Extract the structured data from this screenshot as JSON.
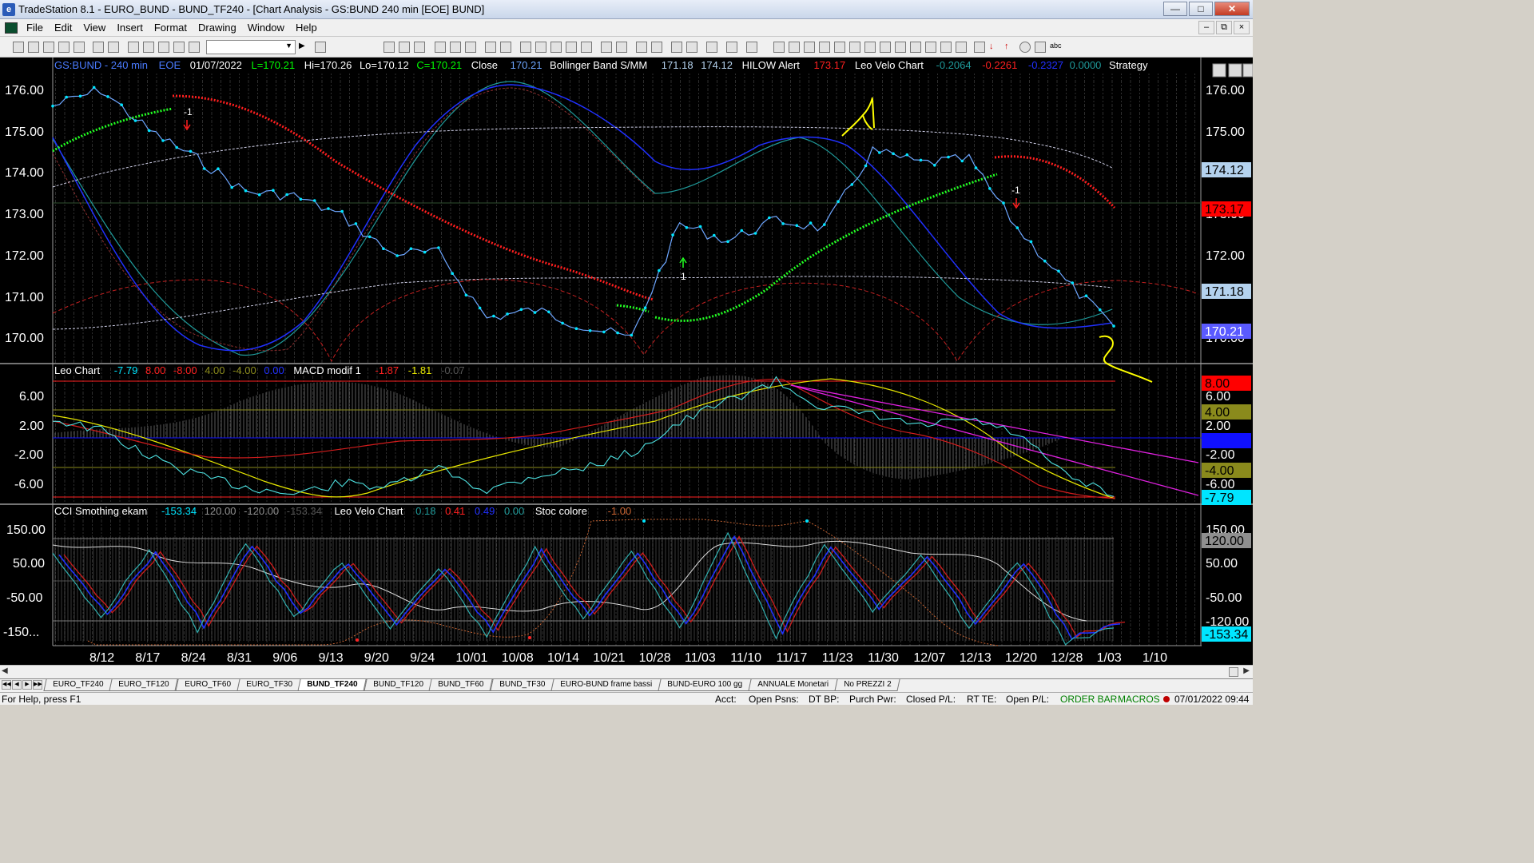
{
  "window": {
    "title": "TradeStation 8.1 - EURO_BUND - BUND_TF240 - [Chart Analysis - GS:BUND  240 min  [EOE] BUND]",
    "minimize": "—",
    "maximize": "□",
    "close": "✕"
  },
  "menu": [
    "File",
    "Edit",
    "View",
    "Insert",
    "Format",
    "Drawing",
    "Window",
    "Help"
  ],
  "chart_header": {
    "symbol": "GS:BUND - 240 min",
    "session": "EOE",
    "date": "01/07/2022",
    "low_label": "L=170.21",
    "hi": "Hi=170.26",
    "lo": "Lo=170.12",
    "close_c": "C=170.21",
    "close_label": "Close",
    "close_val": "170.21",
    "bb_label": "Bollinger Band S/MM",
    "bb_v1": "171.18",
    "bb_v2": "174.12",
    "hilow_label": "HILOW Alert",
    "hilow_val": "173.17",
    "leo_velo_label": "Leo Velo Chart",
    "lv1": "-0.2064",
    "lv2": "-0.2261",
    "lv3": "-0.2327",
    "lv4": "0.0000",
    "strategy": "Strategy"
  },
  "panel2_header": {
    "leo_label": "Leo Chart",
    "v1": "-7.79",
    "v2": "8.00",
    "v3": "-8.00",
    "v4": "4.00",
    "v5": "-4.00",
    "v6": "0.00",
    "macd_label": "MACD modif 1",
    "m1": "-1.87",
    "m2": "-1.81",
    "m3": "-0.07"
  },
  "panel3_header": {
    "cci_label": "CCI Smothing ekam",
    "c1": "-153.34",
    "c2": "120.00",
    "c3": "-120.00",
    "c4": "-153.34",
    "lv_label": "Leo Velo Chart",
    "l1": "0.18",
    "l2": "0.41",
    "l3": "0.49",
    "l4": "0.00",
    "stoc_label": "Stoc colore",
    "s1": "-1.00"
  },
  "annotations": {
    "sig_minus1_a": "-1",
    "sig_minus1_b": "-1",
    "sig_plus1": "1"
  },
  "axis1": {
    "left_ticks": [
      "176.00",
      "175.00",
      "174.00",
      "173.00",
      "172.00",
      "171.00",
      "170.00"
    ],
    "right_ticks": [
      "176.00",
      "175.00",
      "173.00",
      "172.00",
      "170.00"
    ],
    "badges": [
      {
        "label": "174.12",
        "color": "#b4d2ee",
        "text_color": "#000000"
      },
      {
        "label": "173.17",
        "color": "#ff0000",
        "text_color": "#000000"
      },
      {
        "label": "171.18",
        "color": "#b4d2ee",
        "text_color": "#000000"
      },
      {
        "label": "170.21",
        "color": "#5a5aff",
        "text_color": "#ffffff"
      }
    ]
  },
  "axis2": {
    "left_ticks": [
      "6.00",
      "2.00",
      "-2.00",
      "-6.00"
    ],
    "right_ticks": [
      "6.00",
      "2.00",
      "-2.00",
      "-6.00"
    ],
    "badges": [
      {
        "label": "8.00",
        "color": "#ff0000",
        "text_color": "#000000"
      },
      {
        "label": "4.00",
        "color": "#8a8a1c",
        "text_color": "#000000"
      },
      {
        "label": "0.00",
        "color": "#1010ff",
        "text_color": "#1010ff"
      },
      {
        "label": "-4.00",
        "color": "#8a8a1c",
        "text_color": "#000000"
      },
      {
        "label": "-7.79",
        "color": "#00e5ff",
        "text_color": "#000000"
      }
    ]
  },
  "axis3": {
    "left_ticks": [
      "150.00",
      "50.00",
      "-50.00",
      "-150..."
    ],
    "right_ticks": [
      "150.00",
      "50.00",
      "-50.00",
      "-120.00"
    ],
    "badges": [
      {
        "label": "120.00",
        "color": "#8f8f8f",
        "text_color": "#000000"
      },
      {
        "label": "-153.34",
        "color": "#00e5ff",
        "text_color": "#000000"
      }
    ]
  },
  "x_axis": {
    "dates": [
      "8/12",
      "8/17",
      "8/24",
      "8/31",
      "9/06",
      "9/13",
      "9/20",
      "9/24",
      "10/01",
      "10/08",
      "10/14",
      "10/21",
      "10/28",
      "11/03",
      "11/10",
      "11/17",
      "11/23",
      "11/30",
      "12/07",
      "12/13",
      "12/20",
      "12/28",
      "1/03",
      "1/10"
    ]
  },
  "sheet_tabs": [
    {
      "label": "EURO_TF240",
      "active": false
    },
    {
      "label": "EURO_TF120",
      "active": false
    },
    {
      "label": "EURO_TF60",
      "active": false
    },
    {
      "label": "EURO_TF30",
      "active": false
    },
    {
      "label": "BUND_TF240",
      "active": true
    },
    {
      "label": "BUND_TF120",
      "active": false
    },
    {
      "label": "BUND_TF60",
      "active": false
    },
    {
      "label": "BUND_TF30",
      "active": false
    },
    {
      "label": "EURO-BUND frame bassi",
      "active": false
    },
    {
      "label": "BUND-EURO 100 gg",
      "active": false
    },
    {
      "label": "ANNUALE Monetari",
      "active": false
    },
    {
      "label": "No PREZZI 2",
      "active": false
    }
  ],
  "status": {
    "help": "For Help, press F1",
    "acct": "Acct:",
    "open_psns": "Open Psns:",
    "dt_bp": "DT BP:",
    "purch_pwr": "Purch Pwr:",
    "closed_pl": "Closed P/L:",
    "rt_te": "RT TE:",
    "open_pl": "Open P/L:",
    "order_bar": "ORDER BAR",
    "macros": "MACROS",
    "datetime": "07/01/2022 09:44"
  },
  "chart_data": {
    "type": "line",
    "xlabel": "",
    "ylabel": "",
    "x": [
      "8/12",
      "8/17",
      "8/24",
      "8/31",
      "9/06",
      "9/13",
      "9/20",
      "9/24",
      "10/01",
      "10/08",
      "10/14",
      "10/21",
      "10/28",
      "11/03",
      "11/10",
      "11/17",
      "11/23",
      "11/30",
      "12/07",
      "12/13",
      "12/20",
      "12/28",
      "1/03"
    ],
    "panels": [
      {
        "name": "price",
        "ylim": [
          169.3,
          176.4
        ],
        "series": [
          {
            "values": [
              175.6,
              176.0,
              175.0,
              174.3,
              173.5,
              173.4,
              172.9,
              172.0,
              172.0,
              170.4,
              170.6,
              170.2,
              169.9,
              172.7,
              172.3,
              172.8,
              172.6,
              174.5,
              174.2,
              174.3,
              172.6,
              171.3,
              170.2
            ]
          }
        ],
        "color_line": "#00e5ff"
      },
      {
        "name": "leo_chart_macd",
        "ylim": [
          -8.5,
          8.5
        ],
        "series": [
          {
            "values": [
              2.5,
              1.0,
              -2.5,
              -5.0,
              -6.5,
              -7.5,
              -6.0,
              -6.5,
              -4.0,
              -7.0,
              -5.0,
              -4.0,
              -2.0,
              2.0,
              5.0,
              7.5,
              4.0,
              3.0,
              1.5,
              2.5,
              0.5,
              -5.0,
              -7.79
            ]
          }
        ],
        "color_line": "#4de0e0"
      },
      {
        "name": "cci_smoothing",
        "ylim": [
          -210,
          210
        ],
        "series": [
          {
            "values": [
              80,
              -120,
              100,
              -160,
              120,
              -120,
              60,
              -150,
              40,
              -180,
              100,
              -130,
              90,
              -160,
              150,
              -180,
              120,
              -100,
              80,
              -150,
              60,
              -200,
              -153.34
            ]
          }
        ],
        "color_line": "#40c0c0"
      }
    ]
  }
}
